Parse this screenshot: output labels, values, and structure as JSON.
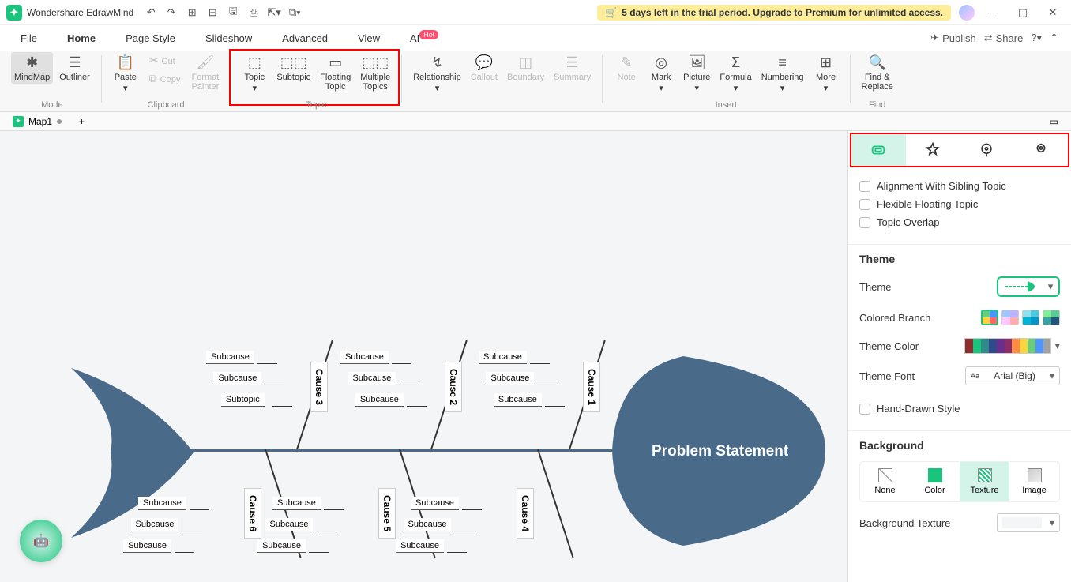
{
  "app": {
    "title": "Wondershare EdrawMind"
  },
  "qat": [
    "undo",
    "redo",
    "sep",
    "new",
    "open",
    "save",
    "print",
    "export",
    "more"
  ],
  "trial": {
    "text": "5 days left in the trial period. Upgrade to Premium for unlimited access."
  },
  "menubar": {
    "items": [
      "File",
      "Home",
      "Page Style",
      "Slideshow",
      "Advanced",
      "View",
      "AI"
    ],
    "active": 1,
    "right": {
      "publish": "Publish",
      "share": "Share"
    }
  },
  "ribbon": {
    "mode": {
      "mindmap": "MindMap",
      "outliner": "Outliner",
      "label": "Mode"
    },
    "clipboard": {
      "paste": "Paste",
      "cut": "Cut",
      "copy": "Copy",
      "formatPainter": "Format\nPainter",
      "label": "Clipboard"
    },
    "topic": {
      "topic": "Topic",
      "subtopic": "Subtopic",
      "floating": "Floating\nTopic",
      "multiple": "Multiple\nTopics",
      "label": "Topic"
    },
    "relationship": "Relationship",
    "callout": "Callout",
    "boundary": "Boundary",
    "summary": "Summary",
    "insert": {
      "note": "Note",
      "mark": "Mark",
      "picture": "Picture",
      "formula": "Formula",
      "numbering": "Numbering",
      "more": "More",
      "label": "Insert"
    },
    "find": {
      "findReplace": "Find &\nReplace",
      "label": "Find"
    }
  },
  "docTabs": {
    "tab1": "Map1"
  },
  "canvas": {
    "problem": "Problem Statement",
    "causes_top": [
      {
        "name": "Cause 3",
        "subs": [
          "Subcause",
          "Subcause",
          "Subtopic"
        ]
      },
      {
        "name": "Cause 2",
        "subs": [
          "Subcause",
          "Subcause",
          "Subcause"
        ]
      },
      {
        "name": "Cause 1",
        "subs": [
          "Subcause",
          "Subcause",
          "Subcause"
        ]
      }
    ],
    "causes_bot": [
      {
        "name": "Cause 6",
        "subs": [
          "Subcause",
          "Subcause",
          "Subcause"
        ]
      },
      {
        "name": "Cause 5",
        "subs": [
          "Subcause",
          "Subcause",
          "Subcause"
        ]
      },
      {
        "name": "Cause 4",
        "subs": [
          "Subcause",
          "Subcause",
          "Subcause"
        ]
      }
    ]
  },
  "side": {
    "checks": {
      "align": "Alignment With Sibling Topic",
      "flex": "Flexible Floating Topic",
      "overlap": "Topic Overlap"
    },
    "theme": {
      "heading": "Theme",
      "themeLbl": "Theme",
      "branchLbl": "Colored Branch",
      "colorLbl": "Theme Color",
      "fontLbl": "Theme Font",
      "fontVal": "Arial (Big)",
      "handLbl": "Hand-Drawn Style"
    },
    "bg": {
      "heading": "Background",
      "none": "None",
      "color": "Color",
      "texture": "Texture",
      "image": "Image",
      "textureLbl": "Background Texture"
    }
  },
  "colors": {
    "fish": "#4a6a8a",
    "strip": [
      "#8b2e2e",
      "#1bc47d",
      "#2e8b8b",
      "#2e4a8b",
      "#6a2e8b",
      "#8b2e6a",
      "#ff8c42",
      "#ffd23f",
      "#6bcb77",
      "#4d96ff",
      "#a0a0a0"
    ]
  }
}
